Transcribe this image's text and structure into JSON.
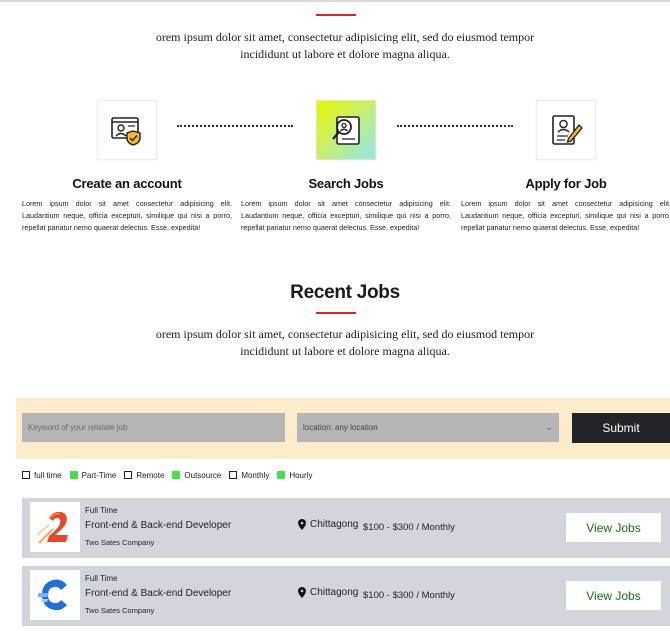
{
  "intro_top": "orem ipsum dolor sit amet, consectetur adipisicing elit, sed do eiusmod tempor incididunt ut labore et dolore magna aliqua.",
  "steps": [
    {
      "icon": "account-shield-icon",
      "title": "Create an account",
      "text": "Lorem ipsum dolor sit amet consectetur adipisicing elit. Laudantium neque, officia excepturi, similique qui nisi a porro, repellat pariatur nemo quaerat delectus. Esse, expedita!"
    },
    {
      "icon": "search-profile-icon",
      "title": "Search Jobs",
      "text": "Lorem ipsum dolor sit amet consectetur adipisicing elit. Laudantium neque, officia excepturi, similique qui nisi a porro, repellat pariatur nemo quaerat delectus. Esse, expedita!"
    },
    {
      "icon": "resume-pencil-icon",
      "title": "Apply for Job",
      "text": "Lorem ipsum dolor sit amet consectetur adipisicing elit. Laudantium neque, officia excepturi, similique qui nisi a porro, repellat pariatur nemo quaerat delectus. Esse, expedita!"
    }
  ],
  "recent": {
    "title": "Recent Jobs",
    "intro": "orem ipsum dolor sit amet, consectetur adipisicing elit, sed do eiusmod tempor incididunt ut labore et dolore magna aliqua."
  },
  "search": {
    "keyword_placeholder": "Keyword of your relatate job",
    "location_value": "location: any location",
    "submit_label": "Submit"
  },
  "filters": [
    {
      "label": "full time",
      "checked": false
    },
    {
      "label": "Part-Time",
      "checked": true
    },
    {
      "label": "Remote",
      "checked": false
    },
    {
      "label": "Outsource",
      "checked": true
    },
    {
      "label": "Monthly",
      "checked": false
    },
    {
      "label": "Hourly",
      "checked": true
    }
  ],
  "jobs": [
    {
      "logo": "number-2-logo",
      "type": "Full Time",
      "title": "Front-end & Back-end Developer",
      "company": "Two Sates Company",
      "location": "Chittagong",
      "salary": "$100 - $300 / Monthly",
      "button": "View Jobs"
    },
    {
      "logo": "letter-c-logo",
      "type": "Full Time",
      "title": "Front-end & Back-end Developer",
      "company": "Two Sates Company",
      "location": "Chittagong",
      "salary": "$100 - $300 / Monthly",
      "button": "View Jobs"
    }
  ],
  "colors": {
    "accent": "#d22b2b",
    "search_bg": "#fdeccc",
    "card_bg": "#d2d6dc",
    "button_dark": "#222428",
    "view_text": "#1d6a1d",
    "checked": "#4ade4a"
  }
}
